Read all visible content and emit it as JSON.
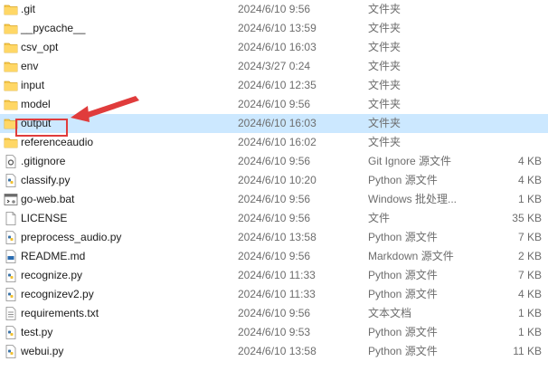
{
  "files": [
    {
      "name": ".git",
      "date": "2024/6/10 9:56",
      "type": "文件夹",
      "size": "",
      "icon": "folder-icon"
    },
    {
      "name": "__pycache__",
      "date": "2024/6/10 13:59",
      "type": "文件夹",
      "size": "",
      "icon": "folder-icon"
    },
    {
      "name": "csv_opt",
      "date": "2024/6/10 16:03",
      "type": "文件夹",
      "size": "",
      "icon": "folder-icon"
    },
    {
      "name": "env",
      "date": "2024/3/27 0:24",
      "type": "文件夹",
      "size": "",
      "icon": "folder-icon"
    },
    {
      "name": "input",
      "date": "2024/6/10 12:35",
      "type": "文件夹",
      "size": "",
      "icon": "folder-icon"
    },
    {
      "name": "model",
      "date": "2024/6/10 9:56",
      "type": "文件夹",
      "size": "",
      "icon": "folder-icon"
    },
    {
      "name": "output",
      "date": "2024/6/10 16:03",
      "type": "文件夹",
      "size": "",
      "icon": "folder-icon",
      "selected": true
    },
    {
      "name": "referenceaudio",
      "date": "2024/6/10 16:02",
      "type": "文件夹",
      "size": "",
      "icon": "folder-icon"
    },
    {
      "name": ".gitignore",
      "date": "2024/6/10 9:56",
      "type": "Git Ignore 源文件",
      "size": "4 KB",
      "icon": "gitignore-file-icon"
    },
    {
      "name": "classify.py",
      "date": "2024/6/10 10:20",
      "type": "Python 源文件",
      "size": "4 KB",
      "icon": "python-file-icon"
    },
    {
      "name": "go-web.bat",
      "date": "2024/6/10 9:56",
      "type": "Windows 批处理...",
      "size": "1 KB",
      "icon": "batch-file-icon"
    },
    {
      "name": "LICENSE",
      "date": "2024/6/10 9:56",
      "type": "文件",
      "size": "35 KB",
      "icon": "blank-file-icon"
    },
    {
      "name": "preprocess_audio.py",
      "date": "2024/6/10 13:58",
      "type": "Python 源文件",
      "size": "7 KB",
      "icon": "python-file-icon"
    },
    {
      "name": "README.md",
      "date": "2024/6/10 9:56",
      "type": "Markdown 源文件",
      "size": "2 KB",
      "icon": "markdown-file-icon"
    },
    {
      "name": "recognize.py",
      "date": "2024/6/10 11:33",
      "type": "Python 源文件",
      "size": "7 KB",
      "icon": "python-file-icon"
    },
    {
      "name": "recognizev2.py",
      "date": "2024/6/10 11:33",
      "type": "Python 源文件",
      "size": "4 KB",
      "icon": "python-file-icon"
    },
    {
      "name": "requirements.txt",
      "date": "2024/6/10 9:56",
      "type": "文本文档",
      "size": "1 KB",
      "icon": "text-file-icon"
    },
    {
      "name": "test.py",
      "date": "2024/6/10 9:53",
      "type": "Python 源文件",
      "size": "1 KB",
      "icon": "python-file-icon"
    },
    {
      "name": "webui.py",
      "date": "2024/6/10 13:58",
      "type": "Python 源文件",
      "size": "11 KB",
      "icon": "python-file-icon"
    }
  ],
  "colors": {
    "selection": "#cce8ff",
    "annotation": "#e03c3c",
    "folder": "#f5c84c"
  }
}
